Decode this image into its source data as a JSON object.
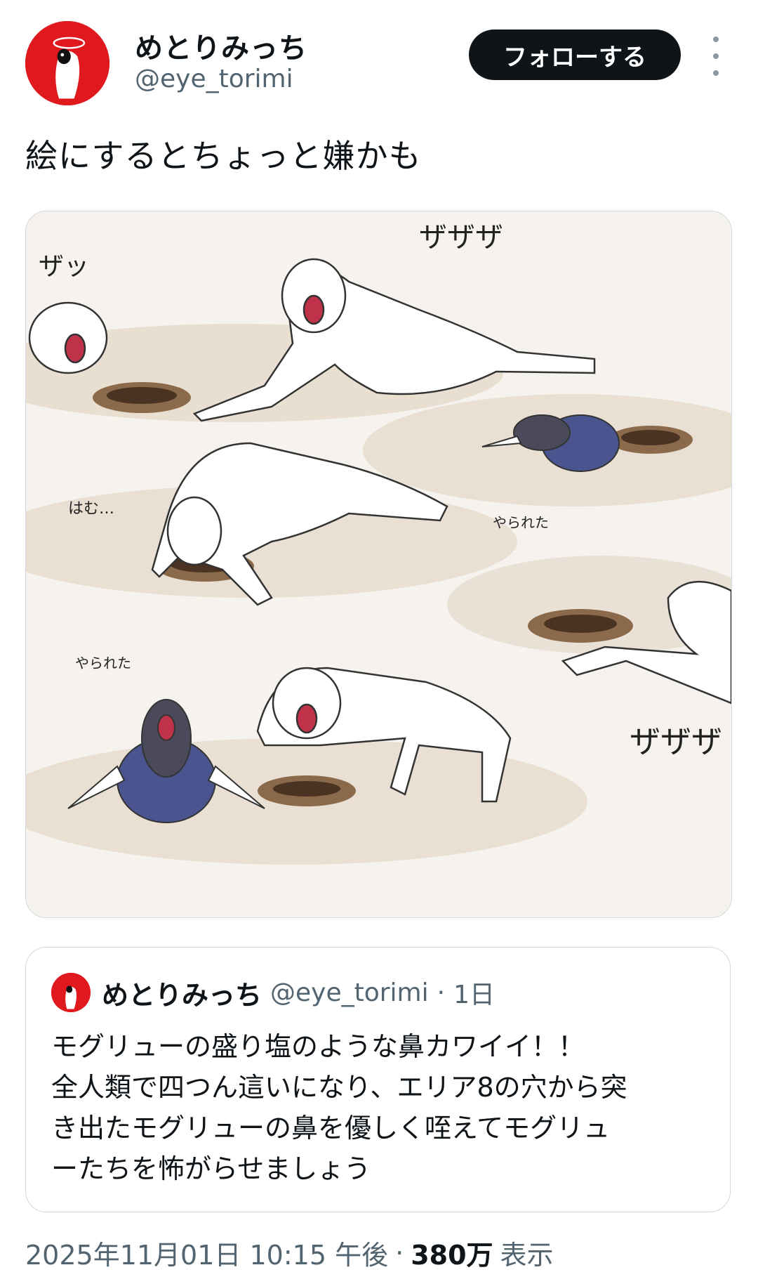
{
  "author": {
    "display_name": "めとりみっち",
    "handle": "@eye_torimi",
    "avatar_icon": "red-circle-character-avatar-icon"
  },
  "actions": {
    "follow_label": "フォローする",
    "more_icon": "vertical-ellipsis-icon"
  },
  "tweet": {
    "text": "絵にするとちょっと嫌かも"
  },
  "media": {
    "sfx": [
      "ザッ",
      "ザザザ",
      "はむ…",
      "やられた",
      "やられた",
      "ザザザ"
    ]
  },
  "quoted_tweet": {
    "display_name": "めとりみっち",
    "handle": "@eye_torimi",
    "separator": "·",
    "time": "1日",
    "lines": [
      "モグリューの盛り塩のような鼻カワイイ！！",
      "全人類で四つん這いになり、エリア8の穴から突",
      "き出たモグリューの鼻を優しく咥えてモグリュ",
      "ーたちを怖がらせましょう"
    ]
  },
  "meta": {
    "timestamp": "2025年11月01日 10:15 午後",
    "separator": "·",
    "views_count": "380万",
    "views_label": "表示"
  },
  "colors": {
    "follow_bg": "#0f1419",
    "avatar_red": "#e0191f",
    "secondary_text": "#536471",
    "border": "#cfd9de"
  }
}
